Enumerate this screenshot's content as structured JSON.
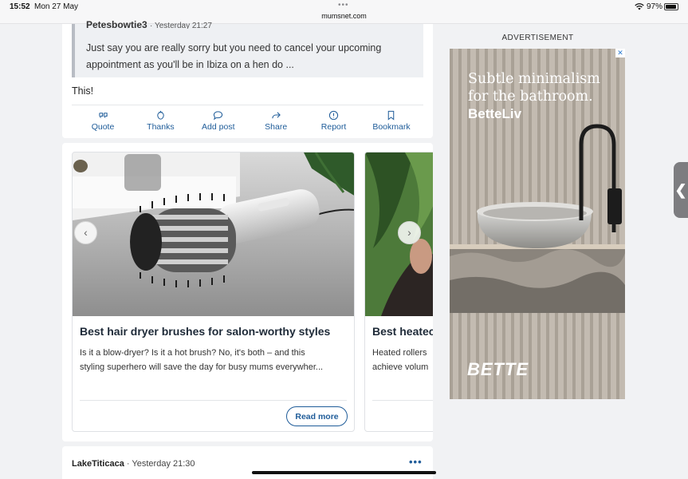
{
  "status_bar": {
    "time": "15:52",
    "date": "Mon 27 May",
    "url": "mumsnet.com",
    "battery": "97%",
    "battery_level": 0.97
  },
  "post": {
    "quote_author": "Petesbowtie3",
    "quote_time": "· Yesterday 21:27",
    "quote_text": "Just say you are really sorry but you need to cancel your upcoming appointment as you'll be in Ibiza on a hen do ...",
    "body": "This!",
    "actions": [
      {
        "label": "Quote",
        "icon": "quote-icon"
      },
      {
        "label": "Thanks",
        "icon": "thanks-icon"
      },
      {
        "label": "Add post",
        "icon": "comment-icon"
      },
      {
        "label": "Share",
        "icon": "share-icon"
      },
      {
        "label": "Report",
        "icon": "info-icon"
      },
      {
        "label": "Bookmark",
        "icon": "bookmark-icon"
      }
    ]
  },
  "carousel": {
    "articles": [
      {
        "title": "Best hair dryer brushes for salon-worthy styles",
        "desc_line1": "Is it a blow-dryer? Is it a hot brush? No, it's both – and this",
        "desc_line2": "styling superhero will save the day for busy mums everywher...",
        "button": "Read more"
      },
      {
        "title": "Best heatec",
        "desc_line1": "Heated rollers",
        "desc_line2": "achieve volum"
      }
    ],
    "prev_icon": "‹",
    "next_icon": "›"
  },
  "next_post": {
    "author": "LakeTiticaca",
    "time": " · Yesterday 21:30",
    "more": "•••"
  },
  "ad": {
    "label": "ADVERTISEMENT",
    "close": "✕",
    "headline_line1": "Subtle minimalism",
    "headline_line2": "for the bathroom.",
    "brand_sub": "BetteLiv",
    "logo": "BETTE"
  },
  "side_handle": "❮",
  "colors": {
    "accent": "#1f5c99",
    "page_bg": "#f1f2f4"
  }
}
